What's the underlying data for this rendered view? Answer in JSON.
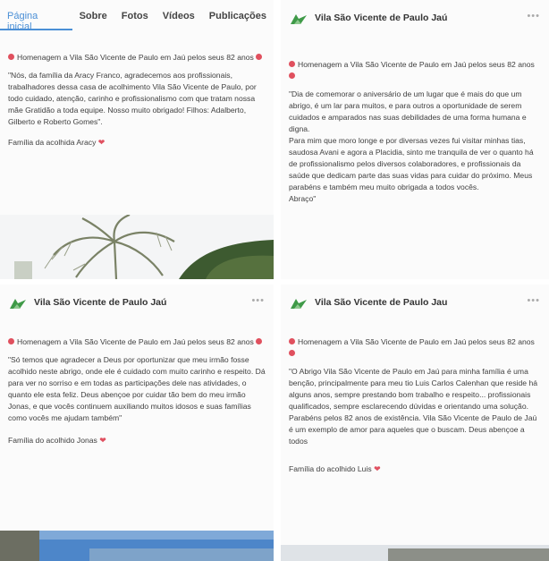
{
  "tabs": [
    "Página inicial",
    "Sobre",
    "Fotos",
    "Vídeos",
    "Publicações"
  ],
  "page_name": "Vila São Vicente de Paulo Jaú",
  "page_name_alt": "Vila São Vicente de Paulo Jau",
  "posts": [
    {
      "heading": "Homenagem a Vila São Vicente de Paulo em Jaú pelos seus 82 anos",
      "quote": "\"Nós, da família da Aracy Franco, agradecemos aos profissionais, trabalhadores dessa casa de acolhimento Vila São Vicente de Paulo, por todo cuidado, atenção, carinho e profissionalismo com que tratam nossa mãe Gratidão a toda equipe. Nosso muito obrigado! Filhos: Adalberto, Gilberto  e Roberto Gomes\".",
      "signature": "Família da acolhida Aracy"
    },
    {
      "heading": "Homenagem a Vila São Vicente de Paulo em Jaú pelos seus 82 anos",
      "quote": "\"Dia de comemorar o aniversário de um lugar que é mais do que um abrigo, é um lar para muitos, e para outros a oportunidade de serem cuidados e amparados nas suas debilidades de uma forma humana e digna.",
      "quote2": "Para mim que moro longe e por diversas vezes fui visitar minhas tias, saudosa Avani e agora a Placidia, sinto me tranquila de ver o quanto há de profissionalismo pelos diversos colaboradores, e profissionais da saúde que dedicam parte das suas vidas para cuidar do próximo. Meus parabéns e também meu muito obrigada a todos vocês.",
      "signature": "Abraço\""
    },
    {
      "heading": "Homenagem a Vila São Vicente de Paulo em Jaú pelos seus 82 anos",
      "quote": "\"Só temos que agradecer a Deus por oportunizar que meu irmão fosse acolhido neste abrigo, onde ele é cuidado com muito carinho e respeito. Dá para ver no sorriso e em todas as participações dele nas atividades, o quanto ele esta feliz. Deus abençoe por cuidar tão bem do meu irmão Jonas, e que vocês continuem auxiliando muitos idosos e suas famílias como vocês me ajudam também\"",
      "signature": "Família do acolhido Jonas"
    },
    {
      "heading": "Homenagem a Vila São Vicente de Paulo em Jaú pelos seus 82 anos",
      "quote": "\"O Abrigo Vila São Vicente de Paulo em Jaú para minha família é uma benção, principalmente para meu tio Luis Carlos Calenhan que reside há alguns anos, sempre prestando bom trabalho e respeito... profissionais qualificados, sempre esclarecendo dúvidas e orientando uma solução. Parabéns pelos 82 anos de existência. Vila São Vicente de Paulo de Jaú é um exemplo de amor para aqueles que o buscam. Deus abençoe a todos",
      "signature": "Família do acolhido Luis"
    }
  ],
  "colors": {
    "accent": "#4a8fd6",
    "heart": "#e05060",
    "logo_green": "#3f9a48"
  }
}
